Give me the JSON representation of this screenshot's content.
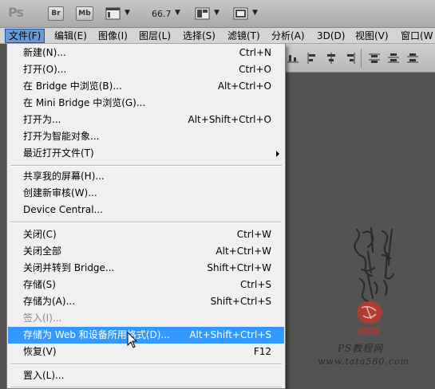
{
  "appbar": {
    "logo": "Ps",
    "br_label": "Br",
    "mb_label": "Mb",
    "zoom": "66.7"
  },
  "menubar": [
    {
      "label": "文件(F)",
      "active": true
    },
    {
      "label": "编辑(E)"
    },
    {
      "label": "图像(I)"
    },
    {
      "label": "图层(L)"
    },
    {
      "label": "选择(S)"
    },
    {
      "label": "滤镜(T)"
    },
    {
      "label": "分析(A)"
    },
    {
      "label": "3D(D)"
    },
    {
      "label": "视图(V)"
    },
    {
      "label": "窗口(W"
    }
  ],
  "file_menu": [
    {
      "label": "新建(N)...",
      "shortcut": "Ctrl+N"
    },
    {
      "label": "打开(O)...",
      "shortcut": "Ctrl+O"
    },
    {
      "label": "在 Bridge 中浏览(B)...",
      "shortcut": "Alt+Ctrl+O"
    },
    {
      "label": "在 Mini Bridge 中浏览(G)...",
      "shortcut": ""
    },
    {
      "label": "打开为...",
      "shortcut": "Alt+Shift+Ctrl+O"
    },
    {
      "label": "打开为智能对象...",
      "shortcut": ""
    },
    {
      "label": "最近打开文件(T)",
      "shortcut": "",
      "submenu": true
    },
    {
      "label": "共享我的屏幕(H)...",
      "shortcut": ""
    },
    {
      "label": "创建新审核(W)...",
      "shortcut": ""
    },
    {
      "label": "Device Central...",
      "shortcut": ""
    },
    {
      "label": "关闭(C)",
      "shortcut": "Ctrl+W"
    },
    {
      "label": "关闭全部",
      "shortcut": "Alt+Ctrl+W"
    },
    {
      "label": "关闭并转到 Bridge...",
      "shortcut": "Shift+Ctrl+W"
    },
    {
      "label": "存储(S)",
      "shortcut": "Ctrl+S"
    },
    {
      "label": "存储为(A)...",
      "shortcut": "Shift+Ctrl+S"
    },
    {
      "label": "签入(I)...",
      "shortcut": "",
      "disabled": true
    },
    {
      "label": "存储为 Web 和设备所用格式(D)...",
      "shortcut": "Alt+Shift+Ctrl+S",
      "highlighted": true
    },
    {
      "label": "恢复(V)",
      "shortcut": "F12"
    },
    {
      "label": "置入(L)...",
      "shortcut": ""
    }
  ],
  "watermark": {
    "site_line1": "PS教程网",
    "site_line2": "www.tata580.com"
  },
  "colors": {
    "highlight": "#3399ff",
    "menu_bg": "#f0f0f0",
    "workspace": "#535353",
    "active_menu": "#6b9bd1"
  }
}
